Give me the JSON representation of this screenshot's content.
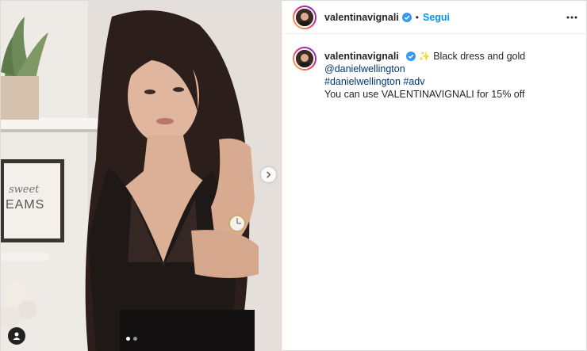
{
  "post": {
    "author": {
      "username": "valentinavignali",
      "verified": true,
      "avatar_icon": "profile-avatar"
    },
    "header": {
      "separator": "•",
      "follow_label": "Segui",
      "more_icon": "more-horizontal-icon"
    },
    "caption": {
      "username": "valentinavignali",
      "emoji": "✨",
      "text_1": "Black dress and gold",
      "mention": "@danielwellington",
      "hashtag_1": "#danielwellington",
      "hashtag_2": "#adv",
      "line_2": "You can use VALENTINAVIGNALI for 15% off"
    },
    "media": {
      "carousel_dots": 2,
      "active_dot": 0,
      "next_icon": "chevron-right-icon",
      "user_tag_icon": "user-tag-icon"
    },
    "colors": {
      "link": "#00376b",
      "follow": "#0095f6",
      "text": "#262626"
    }
  }
}
